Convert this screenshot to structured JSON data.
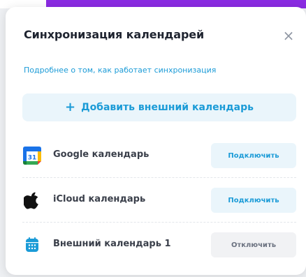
{
  "dialog": {
    "title": "Синхронизация календарей",
    "close_label": "×",
    "help_link": "Подробнее о том, как работает синхронизация",
    "add_button": {
      "icon": "+",
      "label": "Добавить внешний календарь"
    }
  },
  "calendars": [
    {
      "icon": "google-calendar-icon",
      "icon_text": "31",
      "name": "Google календарь",
      "action": "Подключить",
      "state": "connect"
    },
    {
      "icon": "apple-icon",
      "name": "iCloud календарь",
      "action": "Подключить",
      "state": "connect"
    },
    {
      "icon": "calendar-icon",
      "name": "Внешний календарь 1",
      "action": "Отключить",
      "state": "disconnect"
    }
  ],
  "colors": {
    "accent": "#1b9bd7",
    "accent_bg": "#eaf5fb",
    "top_strip": "#8a2be2",
    "title_text": "#1f2430"
  }
}
